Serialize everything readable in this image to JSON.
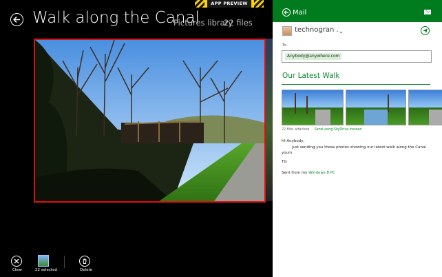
{
  "app_preview_label": "APP PREVIEW",
  "gallery": {
    "title": "Walk along the Canal",
    "library": "Pictures library",
    "file_count": "22 files"
  },
  "appbar": {
    "clear_label": "Clear",
    "selected_label": "22 selected",
    "delete_label": "Delete"
  },
  "mail": {
    "header_title": "Mail",
    "from_name": "technogran .",
    "to_label": "To",
    "to_recipient": "Anybody@anywhere.com",
    "subject": "Our Latest Walk",
    "attachment_info": "22 files attached",
    "skydrive_link": "Send using SkyDrive instead",
    "body": {
      "greeting": "Hi Anybody,",
      "line1": "just sending you these photos showing our latest walk along the Canal",
      "closing": "yours",
      "signature": "TG",
      "sent_from_prefix": "Sent from my ",
      "sent_from_link": "Windows 8 PC"
    }
  },
  "colors": {
    "accent_green": "#007c1e",
    "selection_red": "#dd1111",
    "preview_yellow": "#ffd200"
  },
  "icons": [
    "back-arrow-icon",
    "clear-icon",
    "delete-icon",
    "mail-icon",
    "send-icon",
    "chevron-down-icon"
  ]
}
